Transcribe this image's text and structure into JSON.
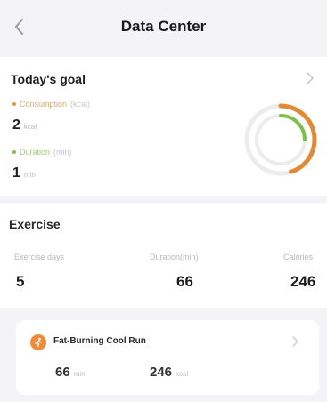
{
  "header": {
    "title": "Data Center"
  },
  "today_goal": {
    "title": "Today's goal",
    "metrics": [
      {
        "label": "Consumption",
        "label_aside": "(kcal)",
        "value": "2",
        "unit": "kcal",
        "color": "#e09a45"
      },
      {
        "label": "Duration",
        "label_aside": "(min)",
        "value": "1",
        "unit": "min",
        "color": "#7cc04a"
      }
    ],
    "ring": {
      "outer_progress": 0.45,
      "inner_progress": 0.25,
      "outer_color": "#e08a35",
      "inner_color": "#7cc04a"
    }
  },
  "exercise": {
    "title": "Exercise",
    "stats": [
      {
        "label": "Exercise days",
        "value": "5"
      },
      {
        "label": "Duration(min)",
        "value": "66"
      },
      {
        "label": "Calories",
        "value": "246"
      }
    ]
  },
  "course": {
    "name": "Fat-Burning Cool Run",
    "duration": {
      "value": "66",
      "unit": "min"
    },
    "calories": {
      "value": "246",
      "unit": "kcal"
    },
    "icon_color": "#f08a3a"
  }
}
